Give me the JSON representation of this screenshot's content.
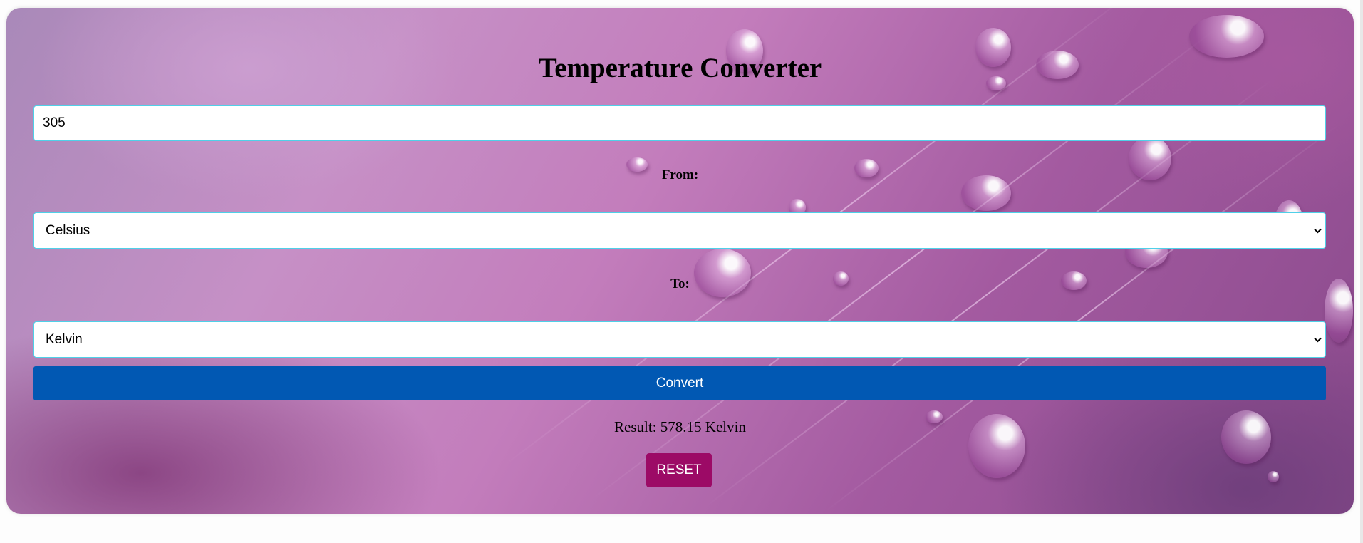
{
  "app": {
    "title": "Temperature Converter"
  },
  "form": {
    "value_input": {
      "value": "305",
      "placeholder": ""
    },
    "from_label": "From:",
    "from_select": {
      "selected": "Celsius",
      "icon": "chevron-down-icon"
    },
    "to_label": "To:",
    "to_select": {
      "selected": "Kelvin",
      "icon": "chevron-down-icon"
    },
    "convert_label": "Convert",
    "result_text": "Result: 578.15 Kelvin",
    "reset_label": "RESET"
  },
  "colors": {
    "convert_button": "#0158b3",
    "reset_button": "#9c0a66",
    "input_border": "#4fd0e8",
    "background_tint": "#c37dbc"
  }
}
